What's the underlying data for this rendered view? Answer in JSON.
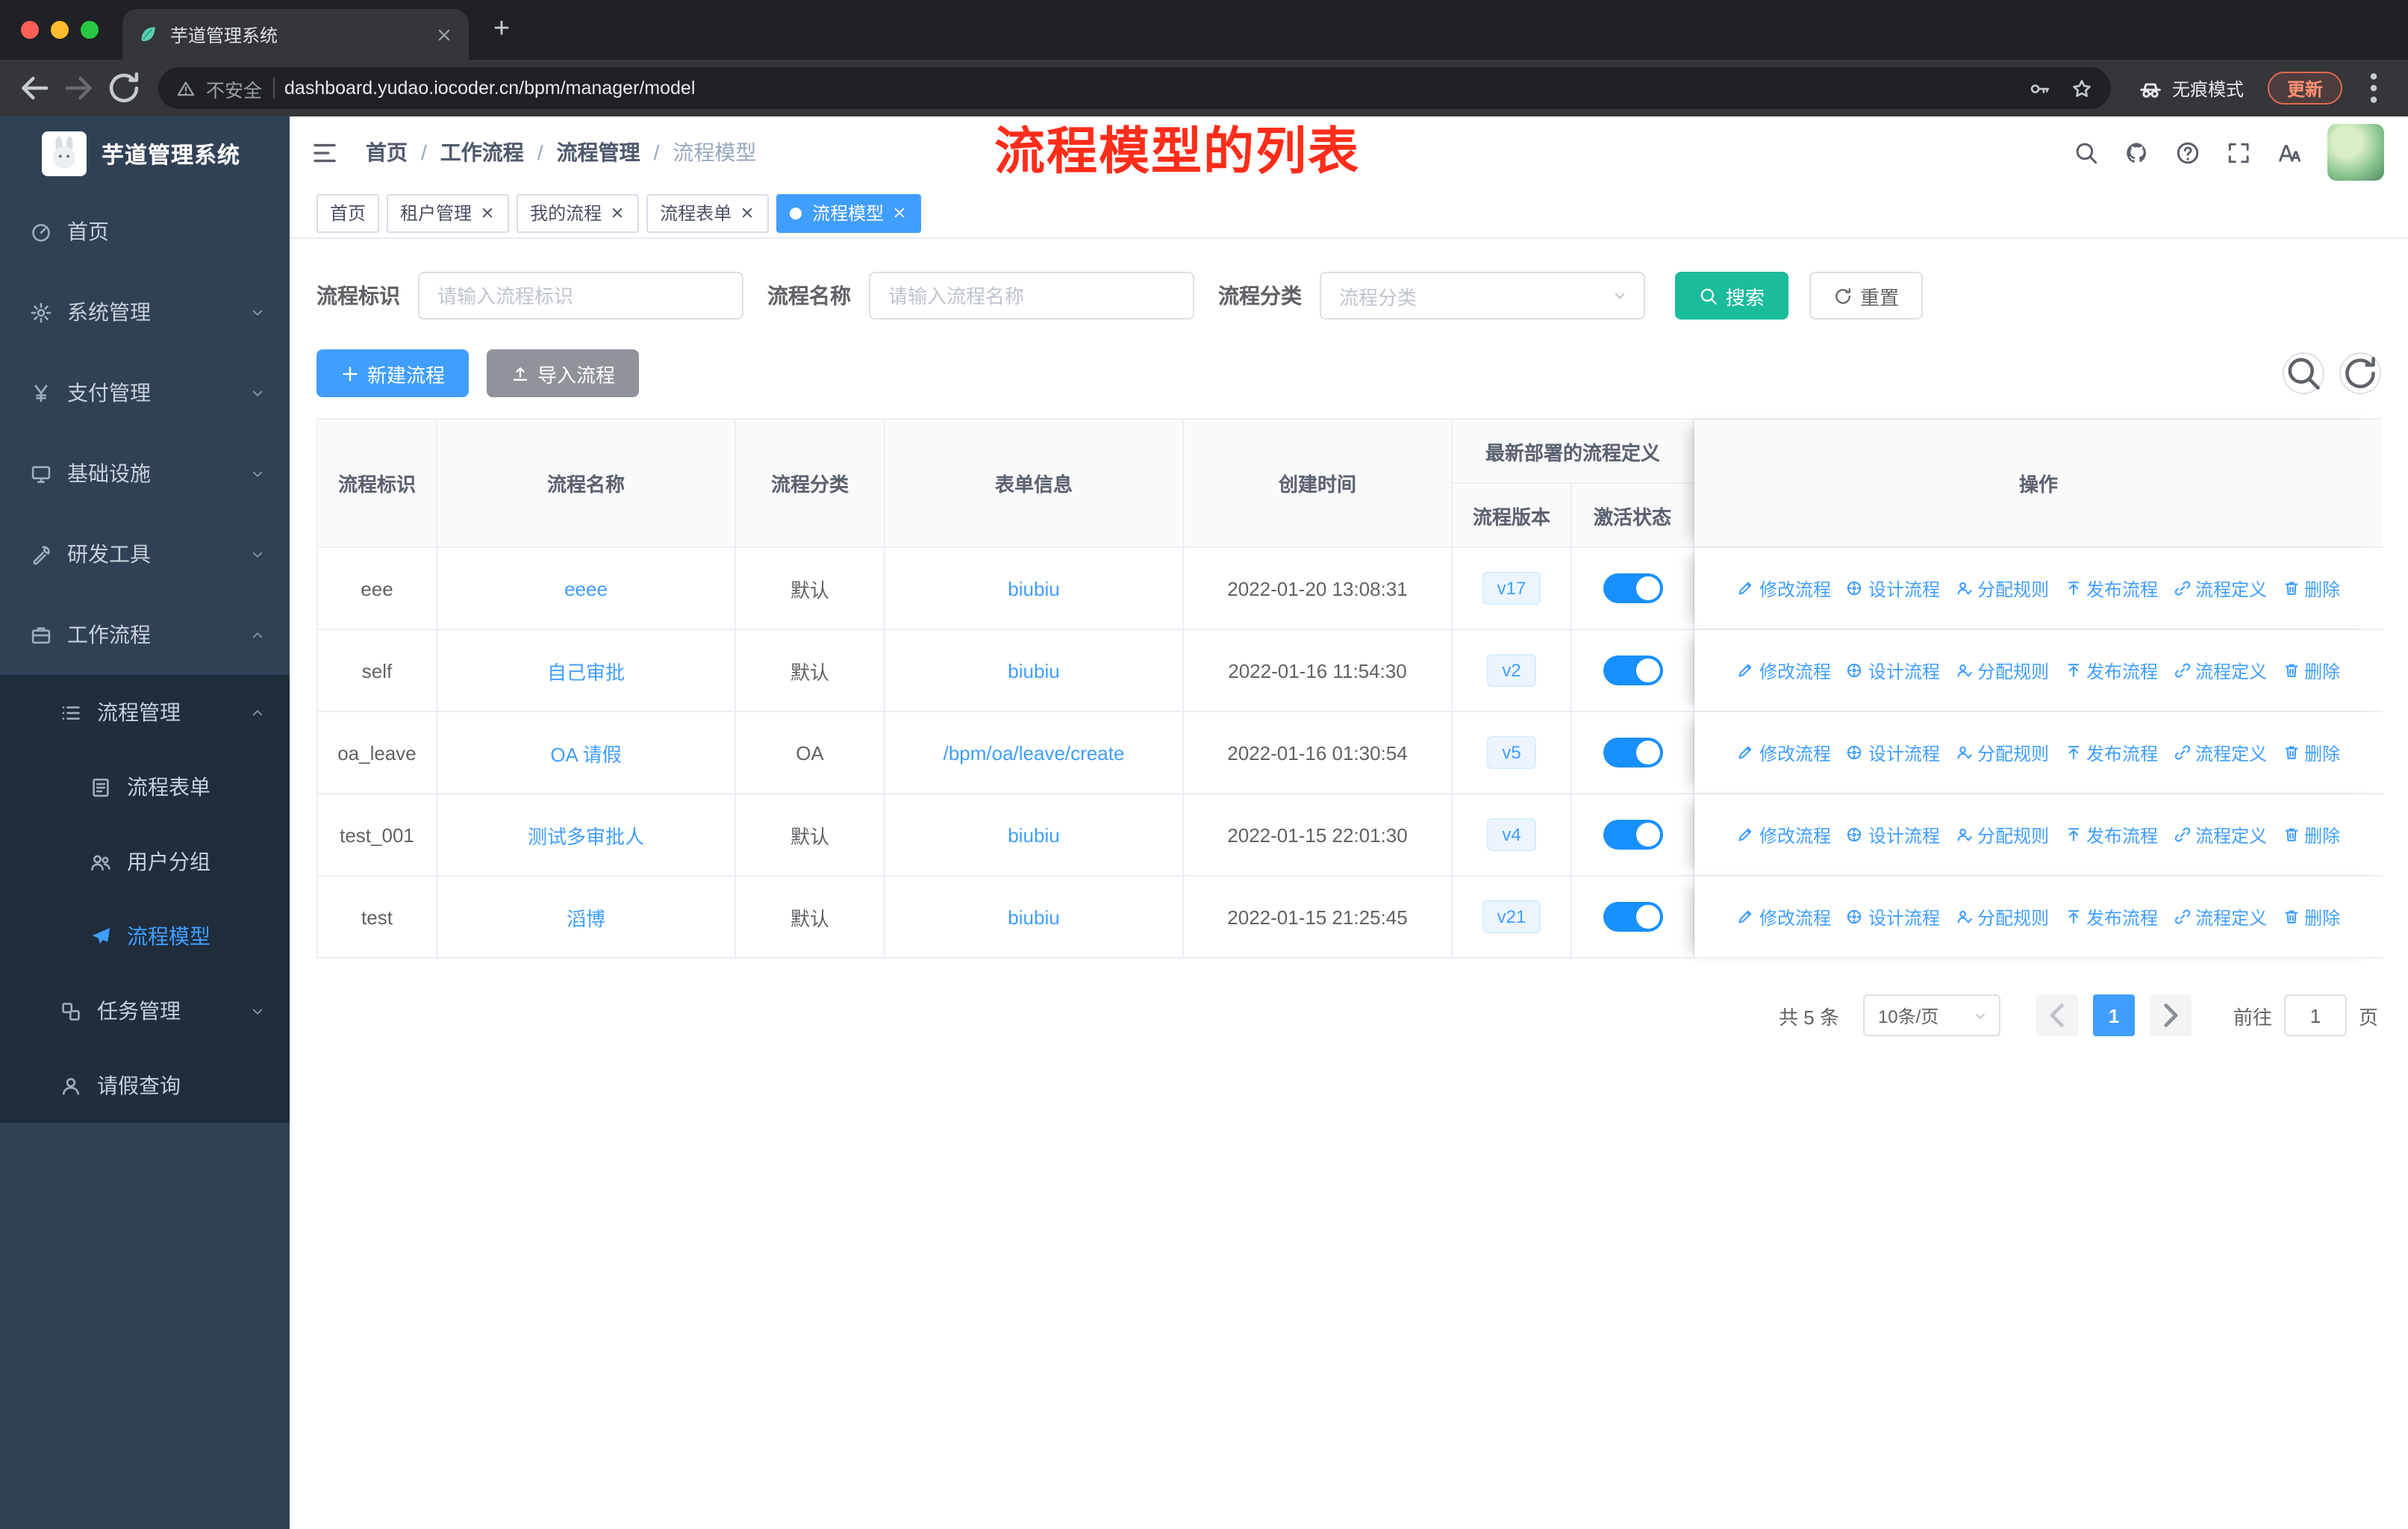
{
  "browser": {
    "tab_title": "芋道管理系统",
    "security_label": "不安全",
    "url": "dashboard.yudao.iocoder.cn/bpm/manager/model",
    "incognito_label": "无痕模式",
    "update_label": "更新"
  },
  "sidebar": {
    "logo_title": "芋道管理系统",
    "items": [
      {
        "name": "home",
        "icon": "dashboard-icon",
        "label": "首页"
      },
      {
        "name": "system",
        "icon": "gear-icon",
        "label": "系统管理",
        "chevron": "down"
      },
      {
        "name": "payment",
        "icon": "yen-icon",
        "label": "支付管理",
        "chevron": "down"
      },
      {
        "name": "infra",
        "icon": "infra-icon",
        "label": "基础设施",
        "chevron": "down"
      },
      {
        "name": "devtools",
        "icon": "tools-icon",
        "label": "研发工具",
        "chevron": "down"
      },
      {
        "name": "workflow",
        "icon": "workflow-icon",
        "label": "工作流程",
        "chevron": "up",
        "children": [
          {
            "name": "process-manage",
            "icon": "list-icon",
            "label": "流程管理",
            "chevron": "up",
            "children": [
              {
                "name": "process-form",
                "icon": "form-icon",
                "label": "流程表单"
              },
              {
                "name": "user-group",
                "icon": "users-icon",
                "label": "用户分组"
              },
              {
                "name": "process-model",
                "icon": "plane-icon",
                "label": "流程模型",
                "active": true
              }
            ]
          },
          {
            "name": "task-manage",
            "icon": "tasks-icon",
            "label": "任务管理",
            "chevron": "down"
          },
          {
            "name": "leave-query",
            "icon": "user-icon",
            "label": "请假查询"
          }
        ]
      }
    ]
  },
  "navbar": {
    "breadcrumb": [
      "首页",
      "工作流程",
      "流程管理",
      "流程模型"
    ],
    "annotation": "流程模型的列表"
  },
  "tags": [
    {
      "label": "首页",
      "closable": false,
      "active": false
    },
    {
      "label": "租户管理",
      "closable": true,
      "active": false
    },
    {
      "label": "我的流程",
      "closable": true,
      "active": false
    },
    {
      "label": "流程表单",
      "closable": true,
      "active": false
    },
    {
      "label": "流程模型",
      "closable": true,
      "active": true
    }
  ],
  "filters": {
    "fields": [
      {
        "name": "process-key",
        "type": "input",
        "label": "流程标识",
        "placeholder": "请输入流程标识"
      },
      {
        "name": "process-name",
        "type": "input",
        "label": "流程名称",
        "placeholder": "请输入流程名称"
      },
      {
        "name": "process-category",
        "type": "select",
        "label": "流程分类",
        "placeholder": "流程分类"
      }
    ],
    "search_label": "搜索",
    "reset_label": "重置"
  },
  "toolbar": {
    "create_label": "新建流程",
    "import_label": "导入流程"
  },
  "table": {
    "columns": [
      {
        "key": "id",
        "label": "流程标识"
      },
      {
        "key": "name",
        "label": "流程名称"
      },
      {
        "key": "category",
        "label": "流程分类"
      },
      {
        "key": "form",
        "label": "表单信息"
      },
      {
        "key": "created",
        "label": "创建时间"
      }
    ],
    "group_header": {
      "label": "最新部署的流程定义",
      "children": [
        {
          "key": "version",
          "label": "流程版本"
        },
        {
          "key": "active",
          "label": "激活状态"
        }
      ]
    },
    "op_header": {
      "label": "操作"
    },
    "actions": [
      {
        "key": "edit",
        "icon": "edit-icon",
        "label": "修改流程"
      },
      {
        "key": "design",
        "icon": "design-icon",
        "label": "设计流程"
      },
      {
        "key": "assign",
        "icon": "assign-icon",
        "label": "分配规则"
      },
      {
        "key": "publish",
        "icon": "publish-icon",
        "label": "发布流程"
      },
      {
        "key": "definition",
        "icon": "definition-icon",
        "label": "流程定义"
      },
      {
        "key": "delete",
        "icon": "delete-icon",
        "label": "删除"
      }
    ],
    "rows": [
      {
        "id": "eee",
        "name": "eeee",
        "category": "默认",
        "form": "biubiu",
        "created": "2022-01-20 13:08:31",
        "version": "v17",
        "active": true
      },
      {
        "id": "self",
        "name": "自己审批",
        "category": "默认",
        "form": "biubiu",
        "created": "2022-01-16 11:54:30",
        "version": "v2",
        "active": true
      },
      {
        "id": "oa_leave",
        "name": "OA 请假",
        "category": "OA",
        "form": "/bpm/oa/leave/create",
        "created": "2022-01-16 01:30:54",
        "version": "v5",
        "active": true
      },
      {
        "id": "test_001",
        "name": "测试多审批人",
        "category": "默认",
        "form": "biubiu",
        "created": "2022-01-15 22:01:30",
        "version": "v4",
        "active": true
      },
      {
        "id": "test",
        "name": "滔博",
        "category": "默认",
        "form": "biubiu",
        "created": "2022-01-15 21:25:45",
        "version": "v21",
        "active": true
      }
    ]
  },
  "pagination": {
    "total_label": "共 5 条",
    "page_size_label": "10条/页",
    "current_page": "1",
    "goto_label": "前往",
    "goto_value": "1",
    "page_unit_label": "页"
  },
  "colors": {
    "accent": "#409eff",
    "search_button": "#1abc9c",
    "create_button": "#409eff",
    "import_button": "#909399",
    "switch_on": "#1890ff",
    "annotation_red": "#ff2d1a",
    "sidebar_bg": "#304156",
    "sidebar_submenu_bg": "#1f2d3d",
    "version_tag_bg": "#ecf5ff"
  }
}
